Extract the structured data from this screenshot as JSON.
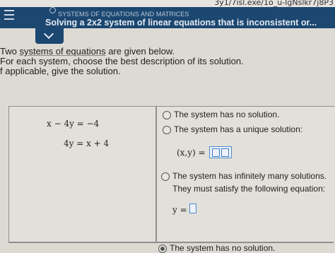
{
  "browser": {
    "url_fragment": "3y1/7isl.exe/1o_u-IgNslkr7j8P3"
  },
  "header": {
    "section": "SYSTEMS OF EQUATIONS AND MATRICES",
    "title": "Solving a 2x2 system of linear equations that is inconsistent or..."
  },
  "instructions": {
    "line1_prefix": "Two ",
    "line1_link": "systems of equations",
    "line1_suffix": " are given below.",
    "line2": "For each system, choose the best description of its solution.",
    "line3": "f applicable, give the solution."
  },
  "system1": {
    "eq1": "x − 4y  =  −4",
    "eq2": "4y  =  x + 4"
  },
  "options": {
    "no_solution": "The system has no solution.",
    "unique": "The system has a unique solution:",
    "unique_expr": "(x,y)  =",
    "infinite_line1": "The system has infinitely many solutions.",
    "infinite_line2": "They must satisfy the following equation:",
    "infinite_expr": "y  ="
  },
  "system2": {
    "no_solution": "The system has no solution."
  }
}
